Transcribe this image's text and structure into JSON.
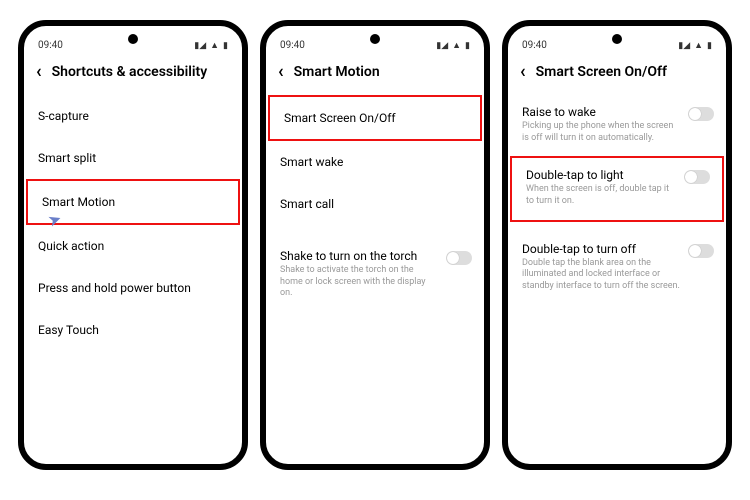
{
  "status": {
    "time": "09:40"
  },
  "phones": [
    {
      "title": "Shortcuts & accessibility",
      "items": [
        {
          "label": "S-capture",
          "highlight": false
        },
        {
          "label": "Smart split",
          "highlight": false
        },
        {
          "label": "Smart Motion",
          "highlight": true,
          "cursor": true
        },
        {
          "label": "Quick action",
          "highlight": false
        },
        {
          "label": "Press and hold power button",
          "highlight": false
        },
        {
          "label": "Easy Touch",
          "highlight": false
        }
      ]
    },
    {
      "title": "Smart Motion",
      "items": [
        {
          "label": "Smart Screen On/Off",
          "highlight": true
        },
        {
          "label": "Smart wake",
          "highlight": false
        },
        {
          "label": "Smart call",
          "highlight": false
        }
      ],
      "toggle_items": [
        {
          "title": "Shake to turn on the torch",
          "desc": "Shake to activate the torch on the home or lock screen with the display on.",
          "highlight": false
        }
      ]
    },
    {
      "title": "Smart Screen On/Off",
      "toggle_items": [
        {
          "title": "Raise to wake",
          "desc": "Picking up the phone when the screen is off will turn it on automatically.",
          "highlight": false
        },
        {
          "title": "Double-tap to light",
          "desc": "When the screen is off, double tap it to turn it on.",
          "highlight": true
        },
        {
          "title": "Double-tap to turn off",
          "desc": "Double tap the blank area on the illuminated and locked interface or standby interface to turn off the screen.",
          "highlight": false
        }
      ]
    }
  ]
}
